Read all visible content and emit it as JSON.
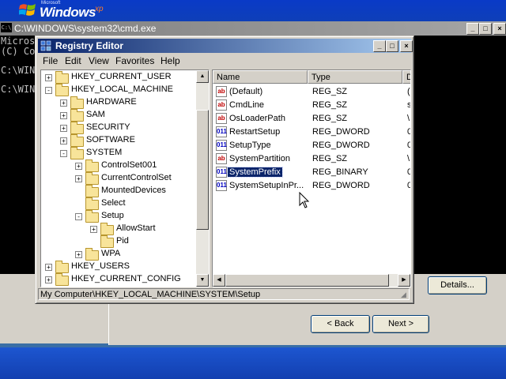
{
  "setup": {
    "brand_small": "Microsoft",
    "brand_main": "Windows",
    "brand_xp": "xp",
    "buttons": {
      "details": "Details...",
      "back": "< Back",
      "next": "Next >"
    }
  },
  "console": {
    "title": "C:\\WINDOWS\\system32\\cmd.exe",
    "icon": "C:\\",
    "lines": [
      "Micros",
      "(C) Co",
      "",
      "C:\\WIN",
      "",
      "C:\\WIN"
    ]
  },
  "regedit": {
    "title": "Registry Editor",
    "menu": [
      "File",
      "Edit",
      "View",
      "Favorites",
      "Help"
    ],
    "tree": [
      {
        "label": "HKEY_CURRENT_USER",
        "level": 0,
        "expander": "+"
      },
      {
        "label": "HKEY_LOCAL_MACHINE",
        "level": 0,
        "expander": "-"
      },
      {
        "label": "HARDWARE",
        "level": 1,
        "expander": "+"
      },
      {
        "label": "SAM",
        "level": 1,
        "expander": "+"
      },
      {
        "label": "SECURITY",
        "level": 1,
        "expander": "+"
      },
      {
        "label": "SOFTWARE",
        "level": 1,
        "expander": "+"
      },
      {
        "label": "SYSTEM",
        "level": 1,
        "expander": "-"
      },
      {
        "label": "ControlSet001",
        "level": 2,
        "expander": "+"
      },
      {
        "label": "CurrentControlSet",
        "level": 2,
        "expander": "+"
      },
      {
        "label": "MountedDevices",
        "level": 2,
        "expander": ""
      },
      {
        "label": "Select",
        "level": 2,
        "expander": ""
      },
      {
        "label": "Setup",
        "level": 2,
        "expander": "-"
      },
      {
        "label": "AllowStart",
        "level": 3,
        "expander": "+"
      },
      {
        "label": "Pid",
        "level": 3,
        "expander": ""
      },
      {
        "label": "WPA",
        "level": 2,
        "expander": "+"
      },
      {
        "label": "HKEY_USERS",
        "level": 0,
        "expander": "+"
      },
      {
        "label": "HKEY_CURRENT_CONFIG",
        "level": 0,
        "expander": "+"
      }
    ],
    "columns": [
      "Name",
      "Type",
      "D"
    ],
    "values": [
      {
        "name": "(Default)",
        "type": "REG_SZ",
        "icon": "ab",
        "data": "(",
        "selected": false
      },
      {
        "name": "CmdLine",
        "type": "REG_SZ",
        "icon": "ab",
        "data": "s",
        "selected": false
      },
      {
        "name": "OsLoaderPath",
        "type": "REG_SZ",
        "icon": "ab",
        "data": "\\",
        "selected": false
      },
      {
        "name": "RestartSetup",
        "type": "REG_DWORD",
        "icon": "011",
        "data": "0",
        "selected": false
      },
      {
        "name": "SetupType",
        "type": "REG_DWORD",
        "icon": "011",
        "data": "0",
        "selected": false
      },
      {
        "name": "SystemPartition",
        "type": "REG_SZ",
        "icon": "ab",
        "data": "\\",
        "selected": false
      },
      {
        "name": "SystemPrefix",
        "type": "REG_BINARY",
        "icon": "011",
        "data": "0",
        "selected": true
      },
      {
        "name": "SystemSetupInPr...",
        "type": "REG_DWORD",
        "icon": "011",
        "data": "0",
        "selected": false
      }
    ],
    "status": "My Computer\\HKEY_LOCAL_MACHINE\\SYSTEM\\Setup"
  },
  "colors": {
    "desktop": "#3a6ea5",
    "title_active": "#0a246a",
    "selection": "#0a246a"
  }
}
